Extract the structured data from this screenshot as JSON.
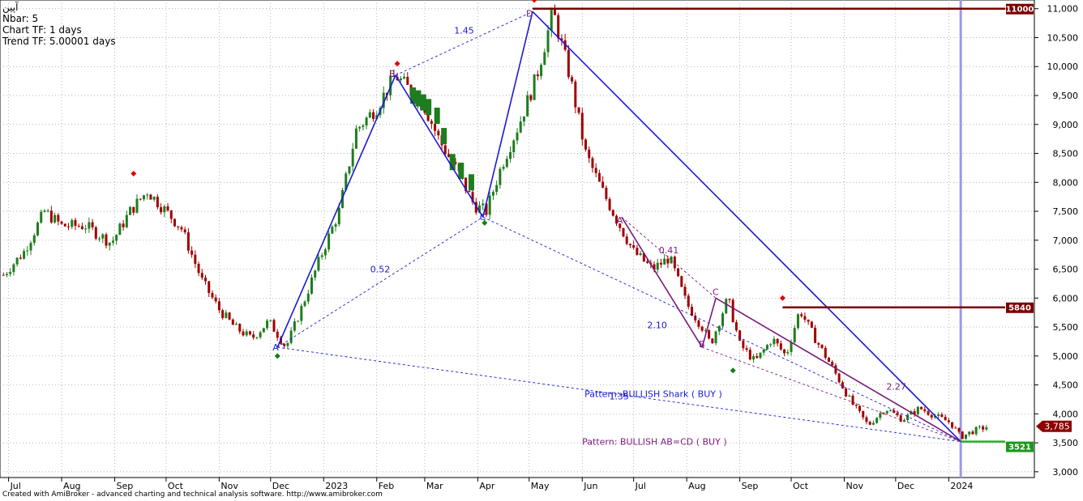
{
  "header": {
    "symbol": "آپین",
    "nbar": "Nbar: 5",
    "chart_tf": "Chart TF: 1 days",
    "trend_tf": "Trend TF: 5.00001 days"
  },
  "footer": "Created with AmiBroker - advanced charting and technical analysis software. http://www.amibroker.com",
  "colors": {
    "up": "#1e7d1e",
    "down": "#a00000",
    "pattern_blue": "#1a1ad6",
    "pattern_purple": "#7a1a7a",
    "resistance": "#7a0000",
    "current_marker": "#9a9ae8",
    "price_tag": "#8b0000",
    "support_tag": "#1b9a1b"
  },
  "chart_data": {
    "type": "candlestick",
    "title": "",
    "xlabel": "",
    "ylabel": "",
    "ylim": [
      2900,
      11150
    ],
    "y_ticks": [
      3000,
      3500,
      4000,
      4500,
      5000,
      5500,
      6000,
      6500,
      7000,
      7500,
      8000,
      8500,
      9000,
      9500,
      10000,
      10500,
      11000
    ],
    "y_tick_labels": [
      "3,000",
      "3,500",
      "4,000",
      "4,500",
      "5,000",
      "5,500",
      "6,000",
      "6,500",
      "7,000",
      "7,500",
      "8,000",
      "8,500",
      "9,000",
      "9,500",
      "10,000",
      "10,500",
      "11,000"
    ],
    "x_months": [
      {
        "label": "Jul",
        "date": "2022-07-01"
      },
      {
        "label": "Aug",
        "date": "2022-08-01"
      },
      {
        "label": "Sep",
        "date": "2022-09-01"
      },
      {
        "label": "Oct",
        "date": "2022-10-01"
      },
      {
        "label": "Nov",
        "date": "2022-11-01"
      },
      {
        "label": "Dec",
        "date": "2022-12-01"
      },
      {
        "label": "2023",
        "date": "2023-01-01"
      },
      {
        "label": "Feb",
        "date": "2023-02-01"
      },
      {
        "label": "Mar",
        "date": "2023-03-01"
      },
      {
        "label": "Apr",
        "date": "2023-04-01"
      },
      {
        "label": "May",
        "date": "2023-05-01"
      },
      {
        "label": "Jun",
        "date": "2023-06-01"
      },
      {
        "label": "Jul",
        "date": "2023-07-01"
      },
      {
        "label": "Aug",
        "date": "2023-08-01"
      },
      {
        "label": "Sep",
        "date": "2023-09-01"
      },
      {
        "label": "Oct",
        "date": "2023-10-01"
      },
      {
        "label": "Nov",
        "date": "2023-11-01"
      },
      {
        "label": "Dec",
        "date": "2023-12-01"
      },
      {
        "label": "2024",
        "date": "2024-01-01"
      }
    ],
    "x_range": [
      "2022-06-26",
      "2024-02-20"
    ],
    "grid": true,
    "price_path": [
      [
        "2022-06-28",
        6400
      ],
      [
        "2022-07-10",
        6800
      ],
      [
        "2022-07-22",
        7500
      ],
      [
        "2022-08-01",
        7250
      ],
      [
        "2022-08-15",
        7250
      ],
      [
        "2022-08-30",
        6950
      ],
      [
        "2022-09-10",
        7500
      ],
      [
        "2022-09-20",
        7850
      ],
      [
        "2022-10-01",
        7500
      ],
      [
        "2022-10-10",
        7200
      ],
      [
        "2022-10-22",
        6300
      ],
      [
        "2022-11-01",
        5800
      ],
      [
        "2022-11-10",
        5500
      ],
      [
        "2022-11-20",
        5300
      ],
      [
        "2022-11-30",
        5600
      ],
      [
        "2022-12-10",
        5150
      ],
      [
        "2022-12-20",
        5900
      ],
      [
        "2022-12-30",
        6700
      ],
      [
        "2023-01-10",
        7500
      ],
      [
        "2023-01-20",
        8900
      ],
      [
        "2023-02-01",
        9300
      ],
      [
        "2023-02-12",
        9850
      ],
      [
        "2023-02-20",
        9600
      ],
      [
        "2023-03-01",
        9300
      ],
      [
        "2023-03-10",
        8700
      ],
      [
        "2023-03-20",
        8200
      ],
      [
        "2023-03-30",
        7600
      ],
      [
        "2023-04-06",
        7500
      ],
      [
        "2023-04-15",
        8300
      ],
      [
        "2023-04-25",
        9000
      ],
      [
        "2023-05-05",
        9800
      ],
      [
        "2023-05-15",
        10950
      ],
      [
        "2023-05-25",
        9800
      ],
      [
        "2023-06-03",
        8500
      ],
      [
        "2023-06-12",
        7900
      ],
      [
        "2023-06-22",
        7300
      ],
      [
        "2023-07-01",
        6800
      ],
      [
        "2023-07-12",
        6500
      ],
      [
        "2023-07-22",
        6700
      ],
      [
        "2023-08-01",
        5900
      ],
      [
        "2023-08-10",
        5500
      ],
      [
        "2023-08-15",
        5200
      ],
      [
        "2023-08-25",
        6000
      ],
      [
        "2023-09-01",
        5200
      ],
      [
        "2023-09-10",
        4900
      ],
      [
        "2023-09-20",
        5300
      ],
      [
        "2023-09-28",
        5000
      ],
      [
        "2023-10-06",
        5800
      ],
      [
        "2023-10-15",
        5300
      ],
      [
        "2023-10-25",
        4800
      ],
      [
        "2023-11-05",
        4200
      ],
      [
        "2023-11-15",
        3800
      ],
      [
        "2023-11-25",
        4100
      ],
      [
        "2023-12-05",
        3900
      ],
      [
        "2023-12-15",
        4100
      ],
      [
        "2023-12-25",
        3950
      ],
      [
        "2024-01-02",
        3850
      ],
      [
        "2024-01-08",
        3600
      ],
      [
        "2024-01-15",
        3700
      ],
      [
        "2024-01-24",
        3785
      ]
    ],
    "green_blocks": [
      [
        "2023-02-22",
        9500
      ],
      [
        "2023-02-25",
        9450
      ],
      [
        "2023-02-28",
        9380
      ],
      [
        "2023-03-03",
        9300
      ],
      [
        "2023-03-08",
        9150
      ],
      [
        "2023-03-12",
        8800
      ],
      [
        "2023-03-17",
        8350
      ],
      [
        "2023-03-22",
        8200
      ],
      [
        "2023-03-28",
        8000
      ]
    ],
    "swing_points": {
      "A": {
        "date": "2022-12-05",
        "price": 5150
      },
      "B": {
        "date": "2023-02-12",
        "price": 9850
      },
      "C": {
        "date": "2023-04-04",
        "price": 7400
      },
      "D": {
        "date": "2023-05-03",
        "price": 10950
      },
      "A2": {
        "date": "2023-06-24",
        "price": 7400
      },
      "B2": {
        "date": "2023-08-10",
        "price": 5150
      },
      "C2": {
        "date": "2023-08-18",
        "price": 6000
      },
      "D2": {
        "date": "2024-01-08",
        "price": 3521
      }
    },
    "point_labels": [
      "A",
      "B",
      "C",
      "D",
      "A",
      "B",
      "C"
    ],
    "ratios": {
      "xb": "0.52",
      "ac": "1.45",
      "ab2": "0.41",
      "bc2": "2.10",
      "cd2": "2.27",
      "pattern_ratio": "1.35"
    },
    "patterns": [
      {
        "label": "Pattern: BULLISH Shark ( BUY )"
      },
      {
        "label": "Pattern: BULLISH AB=CD ( BUY )"
      }
    ],
    "resistance": [
      {
        "price": 11000,
        "label": "11000",
        "from": "2023-05-03"
      },
      {
        "price": 5840,
        "label": "5840",
        "from": "2023-09-26"
      }
    ],
    "support": {
      "price": 3521,
      "label": "3521"
    },
    "last_price": {
      "price": 3785,
      "label": "3,785"
    },
    "current_bar_date": "2024-01-08",
    "peak_markers": [
      [
        "2022-09-12",
        8150
      ],
      [
        "2023-02-13",
        10050
      ],
      [
        "2023-05-04",
        11150
      ],
      [
        "2023-09-26",
        6000
      ]
    ],
    "trough_markers": [
      [
        "2022-12-05",
        5000
      ],
      [
        "2023-04-05",
        7300
      ],
      [
        "2023-08-28",
        4750
      ]
    ]
  }
}
